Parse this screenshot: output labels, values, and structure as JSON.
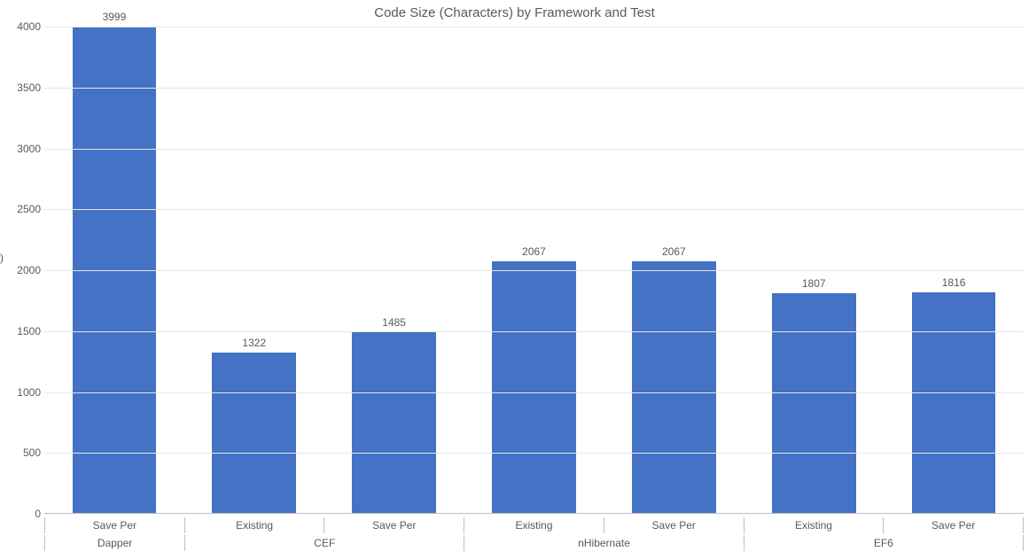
{
  "chart_data": {
    "type": "bar",
    "title": "Code Size (Characters) by Framework and Test",
    "ylabel": "",
    "xlabel": "",
    "ylim": [
      0,
      4000
    ],
    "ytick_step": 500,
    "grid": true,
    "groups": [
      {
        "name": "Dapper",
        "bars": [
          {
            "label": "Save Per",
            "value": 3999
          }
        ]
      },
      {
        "name": "CEF",
        "bars": [
          {
            "label": "Existing",
            "value": 1322
          },
          {
            "label": "Save Per",
            "value": 1485
          }
        ]
      },
      {
        "name": "nHibernate",
        "bars": [
          {
            "label": "Existing",
            "value": 2067
          },
          {
            "label": "Save Per",
            "value": 2067
          }
        ]
      },
      {
        "name": "EF6",
        "bars": [
          {
            "label": "Existing",
            "value": 1807
          },
          {
            "label": "Save Per",
            "value": 1816
          }
        ]
      }
    ],
    "bar_color": "#4472c4"
  }
}
